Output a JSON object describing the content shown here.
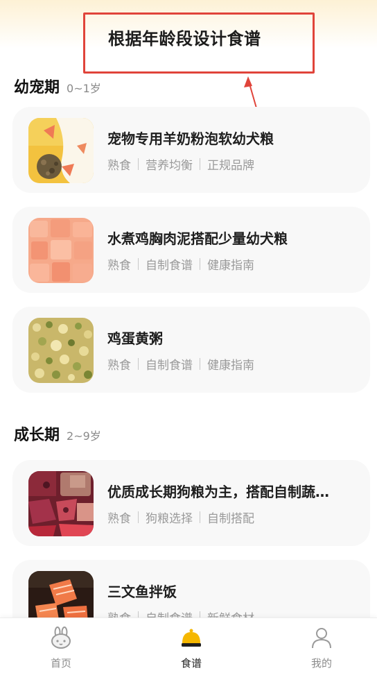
{
  "annotation": {
    "text": "根据年龄段设计食谱"
  },
  "sections": [
    {
      "title": "幼宠期",
      "range": "0~1岁",
      "items": [
        {
          "title": "宠物专用羊奶粉泡软幼犬粮",
          "tags": [
            "熟食",
            "营养均衡",
            "正规品牌"
          ],
          "image": "milk-kibble-photo"
        },
        {
          "title": "水煮鸡胸肉泥搭配少量幼犬粮",
          "tags": [
            "熟食",
            "自制食谱",
            "健康指南"
          ],
          "image": "chicken-breast-photo"
        },
        {
          "title": "鸡蛋黄粥",
          "tags": [
            "熟食",
            "自制食谱",
            "健康指南"
          ],
          "image": "egg-yolk-porridge-photo"
        }
      ]
    },
    {
      "title": "成长期",
      "range": "2~9岁",
      "items": [
        {
          "title": "优质成长期狗粮为主，搭配自制蔬…",
          "tags": [
            "熟食",
            "狗粮选择",
            "自制搭配"
          ],
          "image": "meat-vegetable-photo"
        },
        {
          "title": "三文鱼拌饭",
          "tags": [
            "熟食",
            "自制食谱",
            "新鲜食材"
          ],
          "image": "salmon-photo"
        }
      ]
    }
  ],
  "tabbar": {
    "items": [
      {
        "label": "首页",
        "icon": "rabbit-face-icon",
        "active": false
      },
      {
        "label": "食谱",
        "icon": "chef-hat-icon",
        "active": true
      },
      {
        "label": "我的",
        "icon": "user-icon",
        "active": false
      }
    ]
  },
  "colors": {
    "accent": "#f5b700",
    "annotation_red": "#e0443a",
    "card_bg": "#f8f8f8"
  }
}
